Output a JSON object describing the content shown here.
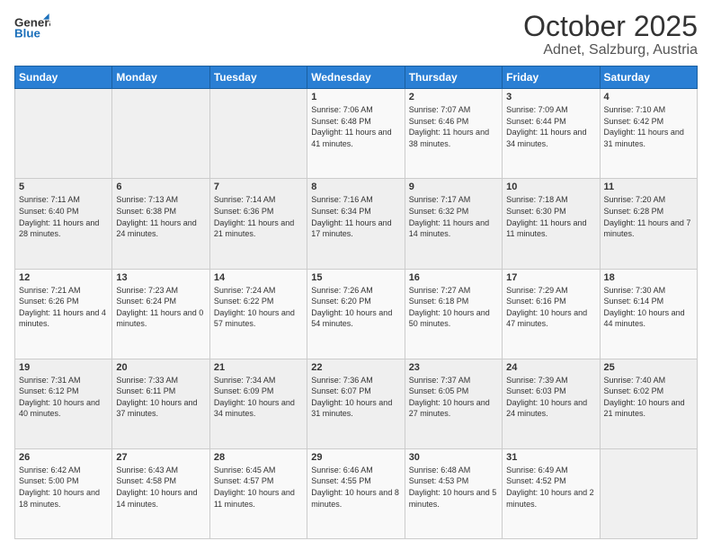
{
  "header": {
    "logo_general": "General",
    "logo_blue": "Blue",
    "title": "October 2025",
    "subtitle": "Adnet, Salzburg, Austria"
  },
  "columns": [
    "Sunday",
    "Monday",
    "Tuesday",
    "Wednesday",
    "Thursday",
    "Friday",
    "Saturday"
  ],
  "weeks": [
    [
      {
        "day": "",
        "sunrise": "",
        "sunset": "",
        "daylight": ""
      },
      {
        "day": "",
        "sunrise": "",
        "sunset": "",
        "daylight": ""
      },
      {
        "day": "",
        "sunrise": "",
        "sunset": "",
        "daylight": ""
      },
      {
        "day": "1",
        "sunrise": "Sunrise: 7:06 AM",
        "sunset": "Sunset: 6:48 PM",
        "daylight": "Daylight: 11 hours and 41 minutes."
      },
      {
        "day": "2",
        "sunrise": "Sunrise: 7:07 AM",
        "sunset": "Sunset: 6:46 PM",
        "daylight": "Daylight: 11 hours and 38 minutes."
      },
      {
        "day": "3",
        "sunrise": "Sunrise: 7:09 AM",
        "sunset": "Sunset: 6:44 PM",
        "daylight": "Daylight: 11 hours and 34 minutes."
      },
      {
        "day": "4",
        "sunrise": "Sunrise: 7:10 AM",
        "sunset": "Sunset: 6:42 PM",
        "daylight": "Daylight: 11 hours and 31 minutes."
      }
    ],
    [
      {
        "day": "5",
        "sunrise": "Sunrise: 7:11 AM",
        "sunset": "Sunset: 6:40 PM",
        "daylight": "Daylight: 11 hours and 28 minutes."
      },
      {
        "day": "6",
        "sunrise": "Sunrise: 7:13 AM",
        "sunset": "Sunset: 6:38 PM",
        "daylight": "Daylight: 11 hours and 24 minutes."
      },
      {
        "day": "7",
        "sunrise": "Sunrise: 7:14 AM",
        "sunset": "Sunset: 6:36 PM",
        "daylight": "Daylight: 11 hours and 21 minutes."
      },
      {
        "day": "8",
        "sunrise": "Sunrise: 7:16 AM",
        "sunset": "Sunset: 6:34 PM",
        "daylight": "Daylight: 11 hours and 17 minutes."
      },
      {
        "day": "9",
        "sunrise": "Sunrise: 7:17 AM",
        "sunset": "Sunset: 6:32 PM",
        "daylight": "Daylight: 11 hours and 14 minutes."
      },
      {
        "day": "10",
        "sunrise": "Sunrise: 7:18 AM",
        "sunset": "Sunset: 6:30 PM",
        "daylight": "Daylight: 11 hours and 11 minutes."
      },
      {
        "day": "11",
        "sunrise": "Sunrise: 7:20 AM",
        "sunset": "Sunset: 6:28 PM",
        "daylight": "Daylight: 11 hours and 7 minutes."
      }
    ],
    [
      {
        "day": "12",
        "sunrise": "Sunrise: 7:21 AM",
        "sunset": "Sunset: 6:26 PM",
        "daylight": "Daylight: 11 hours and 4 minutes."
      },
      {
        "day": "13",
        "sunrise": "Sunrise: 7:23 AM",
        "sunset": "Sunset: 6:24 PM",
        "daylight": "Daylight: 11 hours and 0 minutes."
      },
      {
        "day": "14",
        "sunrise": "Sunrise: 7:24 AM",
        "sunset": "Sunset: 6:22 PM",
        "daylight": "Daylight: 10 hours and 57 minutes."
      },
      {
        "day": "15",
        "sunrise": "Sunrise: 7:26 AM",
        "sunset": "Sunset: 6:20 PM",
        "daylight": "Daylight: 10 hours and 54 minutes."
      },
      {
        "day": "16",
        "sunrise": "Sunrise: 7:27 AM",
        "sunset": "Sunset: 6:18 PM",
        "daylight": "Daylight: 10 hours and 50 minutes."
      },
      {
        "day": "17",
        "sunrise": "Sunrise: 7:29 AM",
        "sunset": "Sunset: 6:16 PM",
        "daylight": "Daylight: 10 hours and 47 minutes."
      },
      {
        "day": "18",
        "sunrise": "Sunrise: 7:30 AM",
        "sunset": "Sunset: 6:14 PM",
        "daylight": "Daylight: 10 hours and 44 minutes."
      }
    ],
    [
      {
        "day": "19",
        "sunrise": "Sunrise: 7:31 AM",
        "sunset": "Sunset: 6:12 PM",
        "daylight": "Daylight: 10 hours and 40 minutes."
      },
      {
        "day": "20",
        "sunrise": "Sunrise: 7:33 AM",
        "sunset": "Sunset: 6:11 PM",
        "daylight": "Daylight: 10 hours and 37 minutes."
      },
      {
        "day": "21",
        "sunrise": "Sunrise: 7:34 AM",
        "sunset": "Sunset: 6:09 PM",
        "daylight": "Daylight: 10 hours and 34 minutes."
      },
      {
        "day": "22",
        "sunrise": "Sunrise: 7:36 AM",
        "sunset": "Sunset: 6:07 PM",
        "daylight": "Daylight: 10 hours and 31 minutes."
      },
      {
        "day": "23",
        "sunrise": "Sunrise: 7:37 AM",
        "sunset": "Sunset: 6:05 PM",
        "daylight": "Daylight: 10 hours and 27 minutes."
      },
      {
        "day": "24",
        "sunrise": "Sunrise: 7:39 AM",
        "sunset": "Sunset: 6:03 PM",
        "daylight": "Daylight: 10 hours and 24 minutes."
      },
      {
        "day": "25",
        "sunrise": "Sunrise: 7:40 AM",
        "sunset": "Sunset: 6:02 PM",
        "daylight": "Daylight: 10 hours and 21 minutes."
      }
    ],
    [
      {
        "day": "26",
        "sunrise": "Sunrise: 6:42 AM",
        "sunset": "Sunset: 5:00 PM",
        "daylight": "Daylight: 10 hours and 18 minutes."
      },
      {
        "day": "27",
        "sunrise": "Sunrise: 6:43 AM",
        "sunset": "Sunset: 4:58 PM",
        "daylight": "Daylight: 10 hours and 14 minutes."
      },
      {
        "day": "28",
        "sunrise": "Sunrise: 6:45 AM",
        "sunset": "Sunset: 4:57 PM",
        "daylight": "Daylight: 10 hours and 11 minutes."
      },
      {
        "day": "29",
        "sunrise": "Sunrise: 6:46 AM",
        "sunset": "Sunset: 4:55 PM",
        "daylight": "Daylight: 10 hours and 8 minutes."
      },
      {
        "day": "30",
        "sunrise": "Sunrise: 6:48 AM",
        "sunset": "Sunset: 4:53 PM",
        "daylight": "Daylight: 10 hours and 5 minutes."
      },
      {
        "day": "31",
        "sunrise": "Sunrise: 6:49 AM",
        "sunset": "Sunset: 4:52 PM",
        "daylight": "Daylight: 10 hours and 2 minutes."
      },
      {
        "day": "",
        "sunrise": "",
        "sunset": "",
        "daylight": ""
      }
    ]
  ]
}
